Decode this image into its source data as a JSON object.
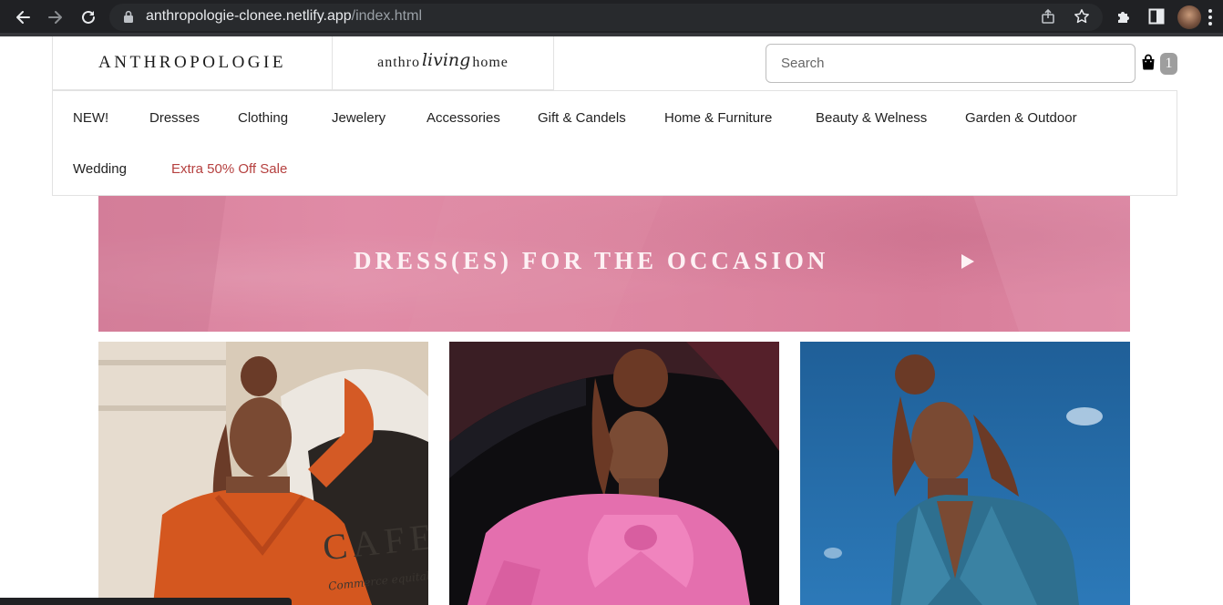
{
  "browser": {
    "url_host": "anthropologie-clonee.netlify.app",
    "url_path": "/index.html"
  },
  "header": {
    "logo": "ANTHROPOLOGIE",
    "living_left": "anthro",
    "living_script": "living",
    "living_right": "home",
    "search_placeholder": "Search",
    "cart_count": "1"
  },
  "categories": [
    "NEW!",
    "Dresses",
    "Clothing",
    "Jewelery",
    "Accessories",
    "Gift & Candels",
    "Home & Furniture",
    "Beauty & Welness",
    "Garden & Outdoor",
    "Wedding",
    "Extra 50% Off Sale"
  ],
  "banner": {
    "text": "DRESS(ES) FOR THE OCCASION"
  },
  "products": [
    {
      "sign_text": "CAFE",
      "sign_subtext": "Commerce equitable"
    },
    {},
    {}
  ],
  "colors": {
    "sale": "#b5403f",
    "banner_pink": "#dd86a1",
    "chrome_dark": "#202124"
  }
}
